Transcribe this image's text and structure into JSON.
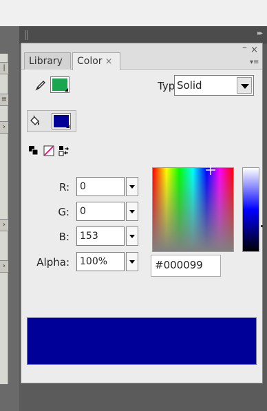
{
  "tabs": [
    {
      "label": "Library"
    },
    {
      "label": "Color",
      "close": "×"
    }
  ],
  "header": {
    "minimize": "–",
    "close": "×",
    "collapse": "▸▸"
  },
  "type": {
    "label": "Type:",
    "value": "Solid"
  },
  "stroke": {
    "color": "#1aa64f"
  },
  "fill": {
    "color": "#000099"
  },
  "channels": {
    "r": {
      "label": "R:",
      "value": "0"
    },
    "g": {
      "label": "G:",
      "value": "0"
    },
    "b": {
      "label": "B:",
      "value": "153"
    },
    "alpha": {
      "label": "Alpha:",
      "value": "100%"
    }
  },
  "hex": {
    "value": "#000099"
  },
  "preview": {
    "color": "#000099"
  },
  "left_strip": {
    "chars": [
      "|",
      "≡",
      "›",
      "›",
      "›"
    ]
  },
  "icons": [
    "pencil-icon",
    "paint-bucket-icon",
    "black-white-icon",
    "no-color-icon",
    "swap-colors-icon",
    "crosshair-icon",
    "panel-menu-icon",
    "grip-icon"
  ]
}
